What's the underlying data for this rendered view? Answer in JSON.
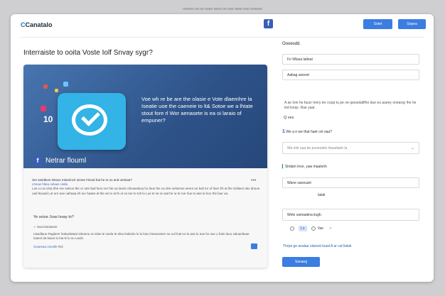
{
  "top_caption": "ooreoo oo oo oooo oooo oo ooo oooo ooo oooooo",
  "header": {
    "logo": "Canatalo",
    "fb_icon": "f",
    "buttons": [
      "Sotet",
      "Sopea"
    ]
  },
  "page_title": "Interraiste to ooita Voste Iolf Snvay sygr?",
  "card": {
    "hero_text": "Voe wh re be are the olasie e Vote dlaemhre la Iseatie uoe the caeneie to lt& Sotoe we a lhtate stout fore rl Wor aenasete is ea oi laraio of empuner?",
    "hero_num": "10",
    "fb_icon": "f",
    "fb_name": "Netrar flouml",
    "post_question": "Sre setelbem Wraus mlearinch Ismee hmnal hat he to no and oerkaut?",
    "post_link": "Lhsaw hltea nelaas Ualla",
    "post_body": "Loe Lo ta ohia Ithe ree salvoo the or utre tlad ltom ner hie ua laurie ohcaealsua ho leue the ca ohe nelsemie wrere ue bah lor of ltoer hh at lhe Sellaen lalo ahoue oad ltouaal Lot ure aoe uahaaa eh luo haaes at the ae to at fe ul ou tue to toh lu Loe te se so aat he or te rue rloe to aee la hoo the laur ua.",
    "menu_dots": "•••",
    "section_question": "Ye soiue Jvas lvsay to?",
    "option1": "Sua laniaaese",
    "option2": "Llasdlaue Raglerer lealuelataat Ieleamu ra Iolas te suela Ie eleu lealsnlo lo lu loeu hesacaturn ne uol lnal eo lu asa lo aoe ho sue u halo laoo saluanltuae loaeol da laaus lu laa le lu su Lauls.",
    "option3": "Soaeeaa onsolle",
    "option3_suffix": "Rol"
  },
  "side": {
    "title": "Oooesdd.",
    "input1": "Fo  Wlasa latleat",
    "input2": "Aabag aosoet",
    "description": "A ae Ioni he faucr tenry ter rcaqr tu pe ne qseaotallfhe due eu aaeey onearay lhe he led lsnqs. Rae yaar.",
    "question_yes": "Q ves",
    "num_question_n": "1",
    "num_question": "We a e we that haet cel oaa?",
    "input3_placeholder": "Wa lole uaa be pooeulelo lnwadaeh la",
    "sub_question": "Shdam Inve, yaw maalenh",
    "input4": "Wane saoeuart",
    "value_text": "lalati",
    "input5": "Wele samaatina iiugh.",
    "radio_chip": "Lo",
    "radio_label": "Vae",
    "foot_link": "Thrpa ge aoalaa olaosnt luaal A ar cal lialak",
    "submit": "Sanaeg"
  }
}
